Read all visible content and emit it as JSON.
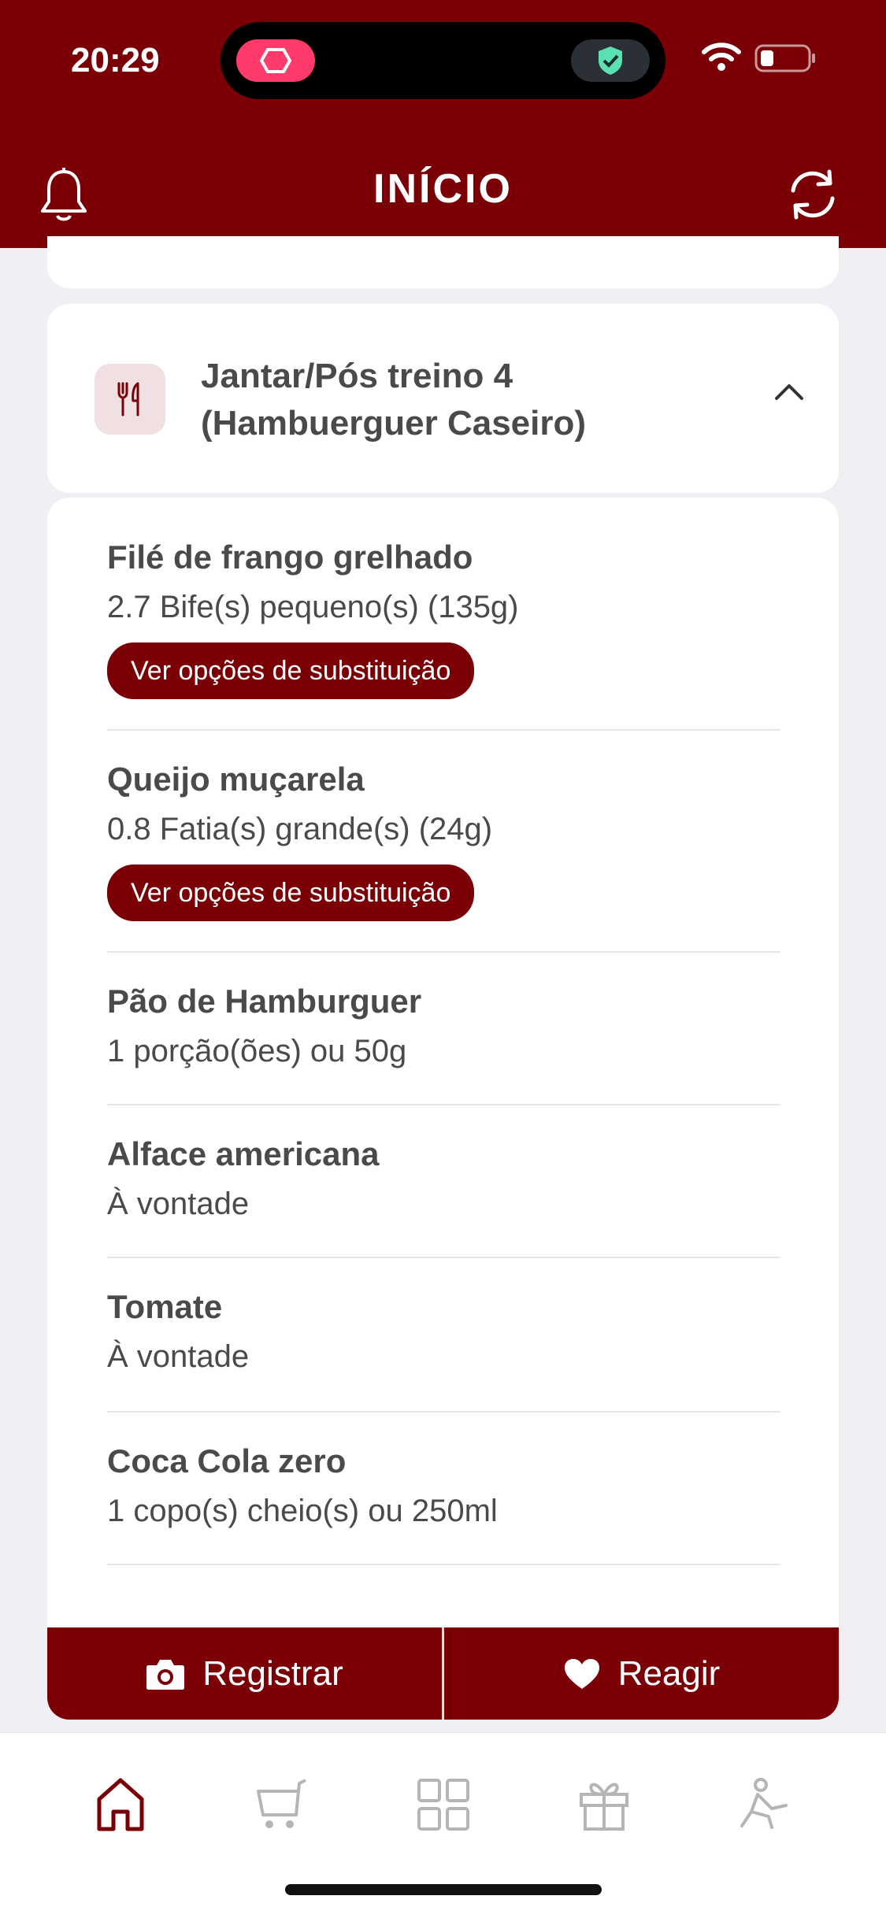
{
  "status_bar": {
    "time": "20:29"
  },
  "header": {
    "title": "INÍCIO"
  },
  "meal": {
    "title": "Jantar/Pós treino 4 (Hambuerguer Caseiro)"
  },
  "items": [
    {
      "name": "Filé de frango grelhado",
      "quantity": "2.7 Bife(s) pequeno(s) (135g)",
      "substitution_label": "Ver opções de substituição"
    },
    {
      "name": "Queijo muçarela",
      "quantity": "0.8 Fatia(s) grande(s) (24g)",
      "substitution_label": "Ver opções de substituição"
    },
    {
      "name": "Pão de Hamburguer",
      "quantity": "1 porção(ões) ou 50g"
    },
    {
      "name": "Alface americana",
      "quantity": "À vontade"
    },
    {
      "name": "Tomate",
      "quantity": "À vontade"
    },
    {
      "name": "Coca Cola zero",
      "quantity": "1 copo(s) cheio(s) ou 250ml"
    }
  ],
  "actions": {
    "register_label": "Registrar",
    "react_label": "Reagir"
  },
  "tabs": [
    {
      "icon": "home-icon",
      "active": true
    },
    {
      "icon": "cart-icon"
    },
    {
      "icon": "grid-icon"
    },
    {
      "icon": "gift-icon"
    },
    {
      "icon": "exercise-icon"
    }
  ],
  "colors": {
    "brand": "#7a0006",
    "background": "#efeff4",
    "text": "#4a4a4a"
  }
}
